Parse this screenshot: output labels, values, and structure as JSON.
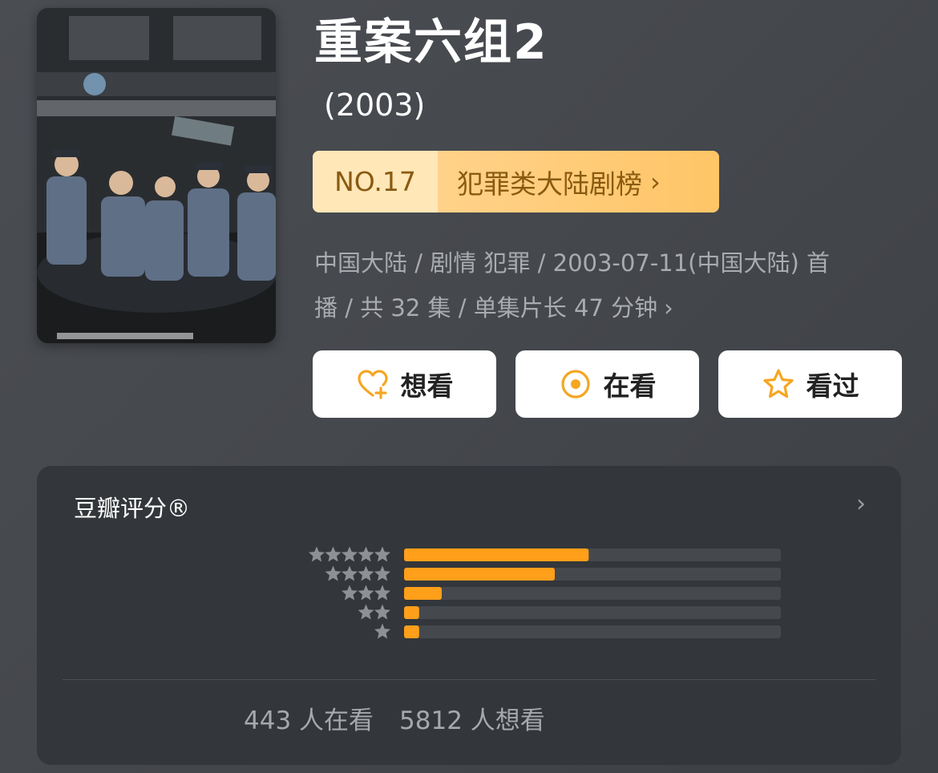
{
  "title": "重案六组2",
  "year": "(2003)",
  "ranking": {
    "number": "NO.17",
    "category": "犯罪类大陆剧榜",
    "chevron": "›"
  },
  "meta": {
    "line1": "中国大陆 / 剧情 犯罪 / 2003-07-11(中国大陆) 首",
    "line2": "播 / 共 32 集 / 单集片长 47 分钟",
    "chevron": "›"
  },
  "actions": [
    {
      "label": "想看",
      "icon": "heart-plus-icon"
    },
    {
      "label": "在看",
      "icon": "target-circle-icon"
    },
    {
      "label": "看过",
      "icon": "star-outline-icon"
    }
  ],
  "rating": {
    "title": "豆瓣评分®",
    "chevron": "›",
    "distribution": [
      {
        "stars": 5,
        "fraction": 0.49
      },
      {
        "stars": 4,
        "fraction": 0.4
      },
      {
        "stars": 3,
        "fraction": 0.1
      },
      {
        "stars": 2,
        "fraction": 0.04
      },
      {
        "stars": 1,
        "fraction": 0.04
      }
    ],
    "watching": "443 人在看",
    "want": "5812 人想看"
  },
  "colors": {
    "accent": "#ff9f1a",
    "bar_track": "#45484c",
    "star_gray": "#8e9093",
    "rank_text": "#8a5a10"
  }
}
